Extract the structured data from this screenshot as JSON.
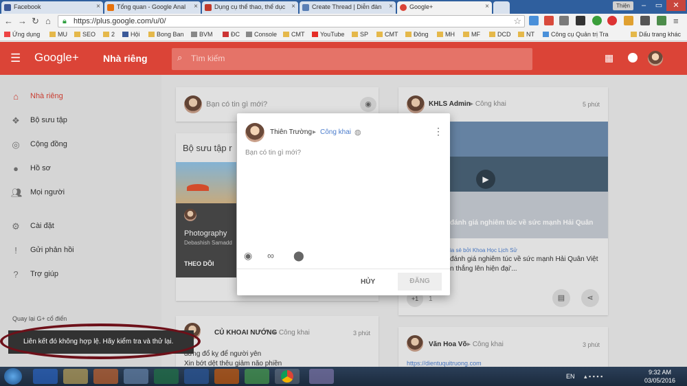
{
  "browser": {
    "tabs": [
      {
        "title": "Facebook",
        "favicon_color": "#3b5998"
      },
      {
        "title": "Tổng quan - Google Anal",
        "favicon_color": "#e8710a"
      },
      {
        "title": "Dụng cụ thể thao, thể dục",
        "favicon_color": "#c0392b"
      },
      {
        "title": "Create Thread | Diễn đàn",
        "favicon_color": "#5a7fb5"
      },
      {
        "title": "Google+",
        "favicon_color": "#db4437"
      }
    ],
    "user_label": "Thiện",
    "url": "https://plus.google.com/u/0/",
    "bookmarks": [
      "Ứng dụng",
      "MU",
      "SEO",
      "2",
      "Hội",
      "Bong Ban",
      "BVM",
      "ĐC",
      "Console",
      "CMT",
      "YouTube",
      "SP",
      "CMT",
      "Đông",
      "MH",
      "MF",
      "DCD",
      "NT",
      "Công cụ Quản trị Tra",
      "Dấu trang khác"
    ]
  },
  "header": {
    "logo": "Google+",
    "section": "Nhà riêng",
    "search_placeholder": "Tìm kiếm"
  },
  "sidebar": {
    "items": [
      {
        "label": "Nhà riêng",
        "icon": "home-icon"
      },
      {
        "label": "Bộ sưu tập",
        "icon": "collections-icon"
      },
      {
        "label": "Cộng đồng",
        "icon": "communities-icon"
      },
      {
        "label": "Hồ sơ",
        "icon": "profile-icon"
      },
      {
        "label": "Mọi người",
        "icon": "people-icon"
      },
      {
        "label": "Cài đặt",
        "icon": "gear-icon"
      },
      {
        "label": "Gửi phản hồi",
        "icon": "feedback-icon"
      },
      {
        "label": "Trợ giúp",
        "icon": "help-icon"
      }
    ],
    "classic_link": "Quay lại G+ cổ điển"
  },
  "feed": {
    "compose_placeholder": "Bạn có tin gì mới?",
    "collections_title": "Bộ sưu tập r",
    "collection": {
      "name": "Photography",
      "owner": "Debashish Samadd",
      "follow": "THEO DÕI"
    },
    "posts": [
      {
        "author": "CỦ KHOAI NƯỚNG",
        "visibility": "Công khai",
        "time": "3 phút",
        "line1": "đừng đổ kỵ để người yên",
        "line2": "Xin bớt dệt thêu giảm não phiền"
      },
      {
        "author": "KHLS Admin",
        "visibility": "Công khai",
        "time": "5 phút",
        "image_caption": "đánh giá nghiêm túc về sức mạnh Hải Quân",
        "shared_by": "ia sẻ bởi Khoa Học Lịch Sử",
        "text1": "đánh giá nghiêm túc về sức mạnh Hải Quân Việt",
        "text2": "n thắng lên hiện đại'...",
        "plus_label": "+1",
        "plus_count": "1"
      },
      {
        "author": "Văn Hoa Võ",
        "visibility": "Công khai",
        "time": "3 phút",
        "link": "https://dientuquitruong.com"
      }
    ]
  },
  "dialog": {
    "user": "Thiên Trường",
    "audience": "Công khai",
    "placeholder": "Bạn có tin gì mới?",
    "cancel": "HỦY",
    "post": "ĐĂNG"
  },
  "toast": {
    "message": "Liên kết đó không hợp lệ. Hãy kiểm tra và thử lại."
  },
  "taskbar": {
    "lang": "EN",
    "time": "9:32 AM",
    "date": "03/05/2016"
  }
}
